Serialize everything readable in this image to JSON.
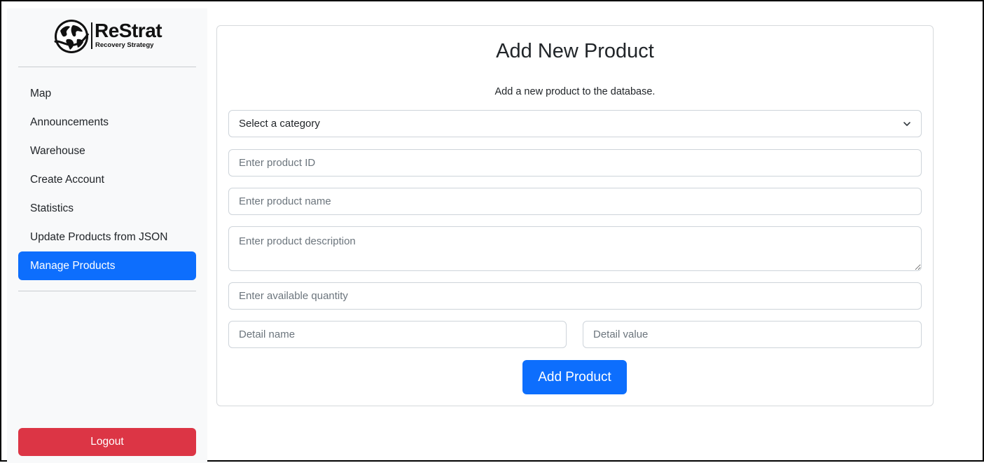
{
  "brand": {
    "name": "ReStrat",
    "tagline": "Recovery Strategy",
    "logo_icon": "globe-icon"
  },
  "sidebar": {
    "items": [
      {
        "label": "Map",
        "active": false
      },
      {
        "label": "Announcements",
        "active": false
      },
      {
        "label": "Warehouse",
        "active": false
      },
      {
        "label": "Create Account",
        "active": false
      },
      {
        "label": "Statistics",
        "active": false
      },
      {
        "label": "Update Products from JSON",
        "active": false
      },
      {
        "label": "Manage Products",
        "active": true
      }
    ],
    "logout_label": "Logout"
  },
  "form": {
    "title": "Add New Product",
    "subtitle": "Add a new product to the database.",
    "category_select": {
      "selected": "Select a category"
    },
    "product_id_placeholder": "Enter product ID",
    "product_name_placeholder": "Enter product name",
    "description_placeholder": "Enter product description",
    "quantity_placeholder": "Enter available quantity",
    "detail_name_placeholder": "Detail name",
    "detail_value_placeholder": "Detail value",
    "submit_label": "Add Product"
  },
  "colors": {
    "primary": "#0d6efd",
    "danger": "#dc3545",
    "sidebar_bg": "#f8f9fa"
  }
}
